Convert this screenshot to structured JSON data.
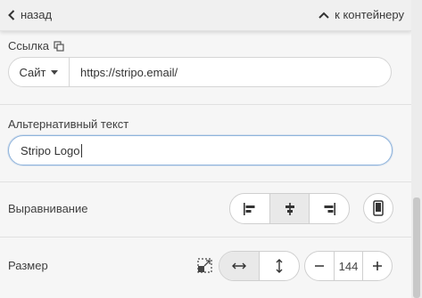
{
  "topbar": {
    "back_label": "назад",
    "container_label": "к контейнеру"
  },
  "link": {
    "label": "Ссылка",
    "type_value": "Сайт",
    "url_value": "https://stripo.email/"
  },
  "alt_text": {
    "label": "Альтернативный текст",
    "value": "Stripo Logo"
  },
  "alignment": {
    "label": "Выравнивание",
    "options": [
      "left-align-icon",
      "center-align-icon",
      "right-align-icon"
    ],
    "active": "center"
  },
  "size": {
    "label": "Размер",
    "width_value": "144"
  },
  "colors": {
    "active_bg": "#e9e9e9",
    "focus_border": "#8fb4dc"
  }
}
